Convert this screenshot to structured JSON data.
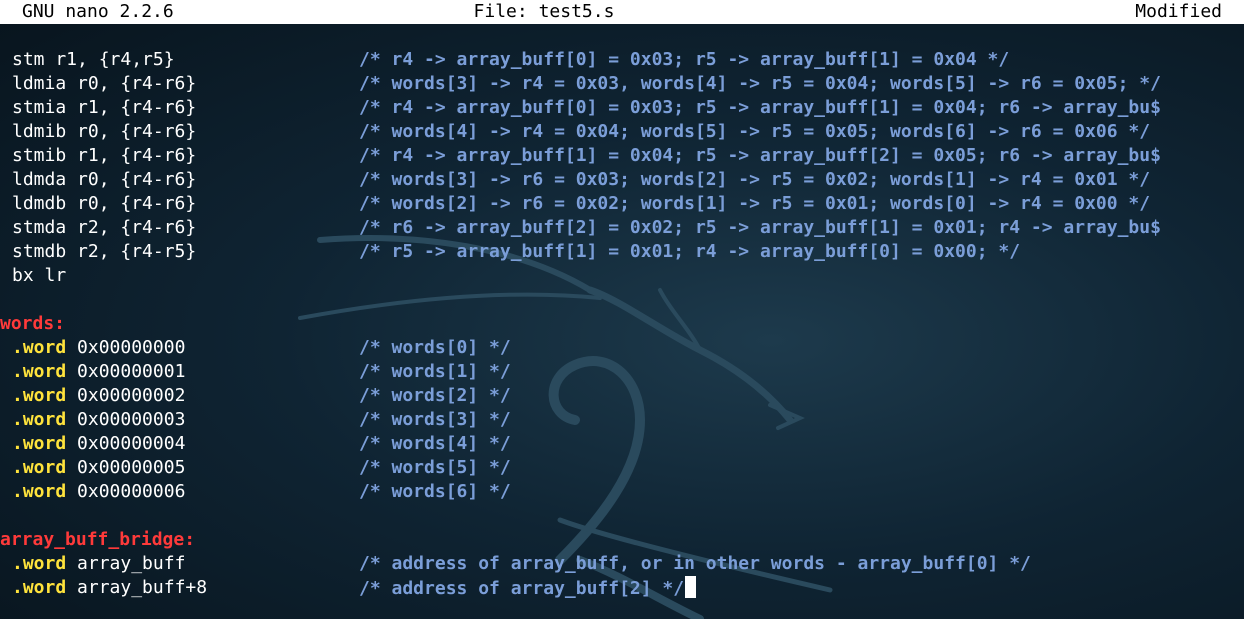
{
  "titlebar": {
    "app": "GNU nano 2.2.6",
    "file": "File: test5.s",
    "status": "Modified"
  },
  "code_lines": [
    {
      "code": "stm r1, {r4,r5}",
      "comment": "/* r4 -> array_buff[0] = 0x03; r5 -> array_buff[1] = 0x04 */"
    },
    {
      "code": "ldmia r0, {r4-r6}",
      "comment": "/* words[3] -> r4 = 0x03, words[4] -> r5 = 0x04; words[5] -> r6 = 0x05; */"
    },
    {
      "code": "stmia r1, {r4-r6}",
      "comment": "/* r4 -> array_buff[0] = 0x03; r5 -> array_buff[1] = 0x04; r6 -> array_bu$"
    },
    {
      "code": "ldmib r0, {r4-r6}",
      "comment": "/* words[4] -> r4 = 0x04; words[5] -> r5 = 0x05; words[6] -> r6 = 0x06 */"
    },
    {
      "code": "stmib r1, {r4-r6}",
      "comment": "/* r4 -> array_buff[1] = 0x04; r5 -> array_buff[2] = 0x05; r6 -> array_bu$"
    },
    {
      "code": "ldmda r0, {r4-r6}",
      "comment": "/* words[3] -> r6 = 0x03; words[2] -> r5 = 0x02; words[1] -> r4 = 0x01 */"
    },
    {
      "code": "ldmdb r0, {r4-r6}",
      "comment": "/* words[2] -> r6 = 0x02; words[1] -> r5 = 0x01; words[0] -> r4 = 0x00 */"
    },
    {
      "code": "stmda r2, {r4-r6}",
      "comment": "/* r6 -> array_buff[2] = 0x02; r5 -> array_buff[1] = 0x01; r4 -> array_bu$"
    },
    {
      "code": "stmdb r2, {r4-r5}",
      "comment": "/* r5 -> array_buff[1] = 0x01; r4 -> array_buff[0] = 0x00; */"
    },
    {
      "code": "bx lr",
      "comment": ""
    }
  ],
  "words_label": "words:",
  "word_directive": ".word",
  "word_lines": [
    {
      "value": "0x00000000",
      "comment": "/* words[0] */"
    },
    {
      "value": "0x00000001",
      "comment": "/* words[1] */"
    },
    {
      "value": "0x00000002",
      "comment": "/* words[2] */"
    },
    {
      "value": "0x00000003",
      "comment": "/* words[3] */"
    },
    {
      "value": "0x00000004",
      "comment": "/* words[4] */"
    },
    {
      "value": "0x00000005",
      "comment": "/* words[5] */"
    },
    {
      "value": "0x00000006",
      "comment": "/* words[6] */"
    }
  ],
  "bridge_label": "array_buff_bridge:",
  "bridge_lines": [
    {
      "value": "array_buff",
      "comment": "/* address of array_buff, or in other words - array_buff[0] */"
    },
    {
      "value": "array_buff+8",
      "comment": "/* address of array_buff[2] */"
    }
  ],
  "colors": {
    "background": "#0f2433",
    "code_text": "#ffffff",
    "comment": "#7b9ed8",
    "label": "#ff3a3a",
    "directive": "#ffe33c",
    "titlebar": "#ffffff"
  }
}
